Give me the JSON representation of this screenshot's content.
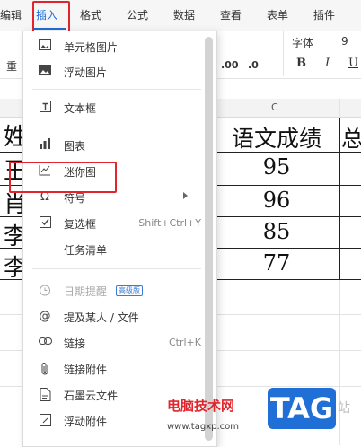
{
  "menubar": {
    "items": [
      "编辑",
      "插入",
      "格式",
      "公式",
      "数据",
      "查看",
      "表单",
      "插件"
    ],
    "active": "插入"
  },
  "toolbar": {
    "font": "字体",
    "font_size": "9",
    "decimal_add": ".00",
    "decimal_remove": ".0",
    "bold": "B",
    "italic": "I",
    "underline": "U",
    "left_text": "重"
  },
  "sheet": {
    "col_c": "C",
    "header_c": "语文成绩",
    "header_d": "总",
    "header_a": "姓",
    "names": [
      "王",
      "肖",
      "李",
      "李"
    ],
    "scores": [
      "95",
      "96",
      "85",
      "77"
    ]
  },
  "menu": {
    "items": [
      {
        "label": "单元格图片",
        "icon": "cell-image-icon"
      },
      {
        "label": "浮动图片",
        "icon": "image-icon"
      },
      {
        "label": "文本框",
        "icon": "textbox-icon"
      },
      {
        "label": "图表",
        "icon": "chart-icon"
      },
      {
        "label": "迷你图",
        "icon": "sparkline-icon"
      },
      {
        "label": "符号",
        "icon": "omega-icon"
      },
      {
        "label": "复选框",
        "icon": "checkbox-icon",
        "shortcut": "Shift+Ctrl+Y"
      },
      {
        "label": "任务清单",
        "icon": ""
      },
      {
        "label": "日期提醒",
        "icon": "alarm-icon",
        "badge": "高级版"
      },
      {
        "label": "提及某人 / 文件",
        "icon": "at-icon"
      },
      {
        "label": "链接",
        "icon": "link-icon",
        "shortcut": "Ctrl+K"
      },
      {
        "label": "链接附件",
        "icon": "paperclip-icon"
      },
      {
        "label": "石墨云文件",
        "icon": "cloud-file-icon"
      },
      {
        "label": "浮动附件",
        "icon": "attachment-icon"
      }
    ]
  },
  "watermark": {
    "site_name": "电脑技术网",
    "url": "www.tagxp.com",
    "logo": "TAG",
    "suffix": "站"
  }
}
